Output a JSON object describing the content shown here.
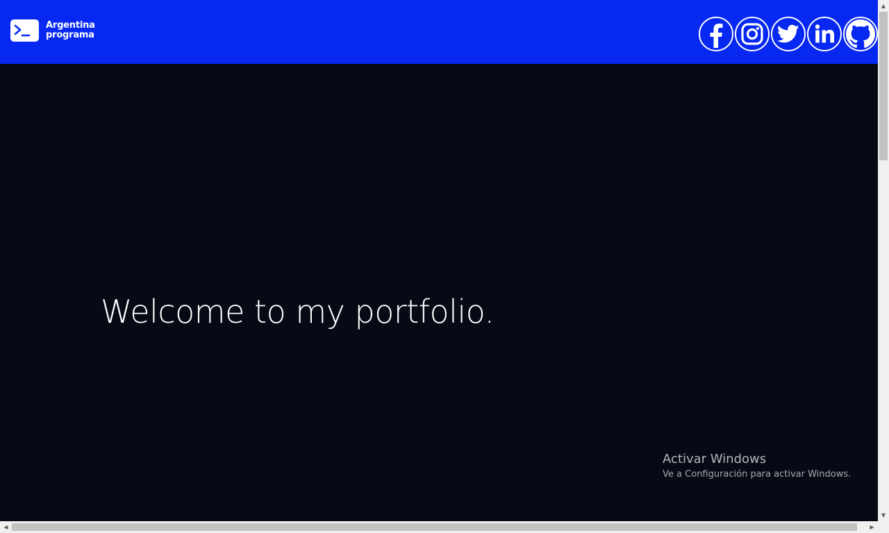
{
  "header": {
    "logo": {
      "icon": "terminal-icon",
      "line1": "Argentina",
      "line2": "programa"
    },
    "socials": [
      {
        "icon": "facebook-icon"
      },
      {
        "icon": "instagram-icon"
      },
      {
        "icon": "twitter-icon"
      },
      {
        "icon": "linkedin-icon"
      },
      {
        "icon": "github-icon"
      }
    ]
  },
  "hero": {
    "title": "Welcome to my portfolio."
  },
  "watermark": {
    "title": "Activar Windows",
    "subtitle": "Ve a Configuración para activar Windows."
  },
  "colors": {
    "header_bg": "#0628f0",
    "page_bg": "#050a15",
    "text": "#ffffff"
  }
}
